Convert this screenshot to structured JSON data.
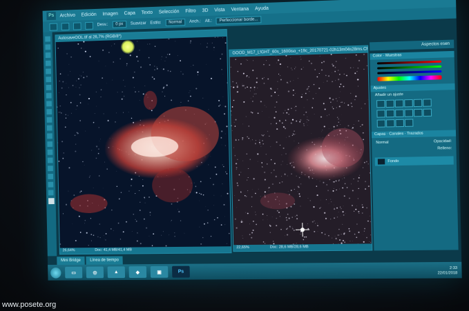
{
  "menu": {
    "app_icon": "Ps",
    "items": [
      "Archivo",
      "Edición",
      "Imagen",
      "Capa",
      "Texto",
      "Selección",
      "Filtro",
      "3D",
      "Vista",
      "Ventana",
      "Ayuda"
    ]
  },
  "options": {
    "blur_label": "Desv.:",
    "blur_value": "0 px",
    "smooth_label": "Suavizar",
    "style_label": "Estilo:",
    "style_value": "Normal",
    "width_label": "Anch.:",
    "height_label": "Alt.:",
    "refine_button": "Perfeccionar borde..."
  },
  "doc_left": {
    "tab": "AutosaveOOL.tif al 26,7% (RGB/8*)",
    "zoom": "26,64%",
    "status": "Doc: 41,4 MB/41,4 MB"
  },
  "doc_right": {
    "tab": "GOOD_M17_LIGHT_60s_1600iso_+19c_20170721-02h13m04s28ms.CR2 al 22,6% (RGB/8)",
    "zoom": "22,65%",
    "status": "Doc: 28,6 MB/28,6 MB"
  },
  "panels": {
    "workspace": "Aspectos esen",
    "color_tab": "Color",
    "swatches_tab": "Muestras",
    "adjust_tab": "Ajustes",
    "adjust_add": "Añadir un ajuste",
    "layers_tab": "Capas",
    "channels_tab": "Canales",
    "paths_tab": "Trazados",
    "blend_mode": "Normal",
    "opacity_label": "Opacidad:",
    "fill_label": "Relleno:",
    "layer_name": "Fondo"
  },
  "bottom_tabs": [
    "Mini Bridge",
    "Línea de tiempo"
  ],
  "taskbar": {
    "apps": [
      "explorer-icon",
      "chrome-icon",
      "folder-icon",
      "paint-icon",
      "slideshow-icon",
      "photoshop-icon"
    ],
    "ps_label": "Ps",
    "time": "2:33",
    "date": "22/01/2018"
  },
  "watermark": "www.posete.org",
  "colors": {
    "accent": "#1a7d96",
    "panel": "#146a82",
    "nebula": "#e06a5a"
  }
}
